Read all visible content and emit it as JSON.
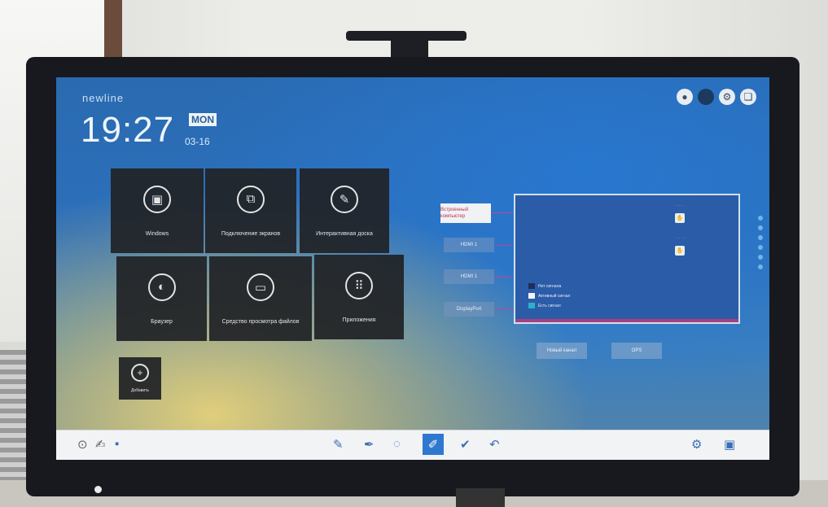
{
  "screen": {
    "brand": "newline",
    "time": "19:27",
    "day": "MON",
    "date": "03-16",
    "top_icons": [
      "record-icon",
      "dark-circle-icon",
      "settings-icon",
      "layers-icon"
    ]
  },
  "tiles": [
    {
      "label": "Windows",
      "icon": "windows-icon"
    },
    {
      "label": "Подключение экранов",
      "icon": "screen-share-icon"
    },
    {
      "label": "Интерактивная доска",
      "icon": "pen-circle-icon"
    },
    {
      "label": "Браузер",
      "icon": "browser-icon"
    },
    {
      "label": "Средство просмотра файлов",
      "icon": "folder-icon"
    },
    {
      "label": "Приложения",
      "icon": "apps-grid-icon"
    },
    {
      "label": "Добавить",
      "icon": "add-icon"
    }
  ],
  "sources": [
    {
      "label": "Встроенный компьютер",
      "active": true
    },
    {
      "label": "HDMI 1",
      "active": false
    },
    {
      "label": "HDMI 1",
      "active": false
    },
    {
      "label": "DisplayPort",
      "active": false
    }
  ],
  "preview": {
    "legend": [
      {
        "label": "Нет сигнала",
        "color": "#1d2f5a"
      },
      {
        "label": "Активный сигнал",
        "color": "#f2f4f7"
      },
      {
        "label": "Есть сигнал",
        "color": "#2fb0c8"
      }
    ]
  },
  "bottom_buttons": [
    "Новый канал",
    "OPS"
  ],
  "taskbar": {
    "left": [
      "home-icon",
      "annotate-icon",
      "lock-icon"
    ],
    "center": [
      "pen-icon",
      "pen-icon",
      "lasso-icon",
      "eraser-icon",
      "check-icon",
      "undo-icon"
    ],
    "right": [
      "settings-icon",
      "windows-icon"
    ]
  },
  "colors": {
    "tile_bg": "#202226",
    "taskbar_bg": "#f2f3f5",
    "active_tool": "#2e78d0",
    "accent_magenta": "#c9409a"
  }
}
